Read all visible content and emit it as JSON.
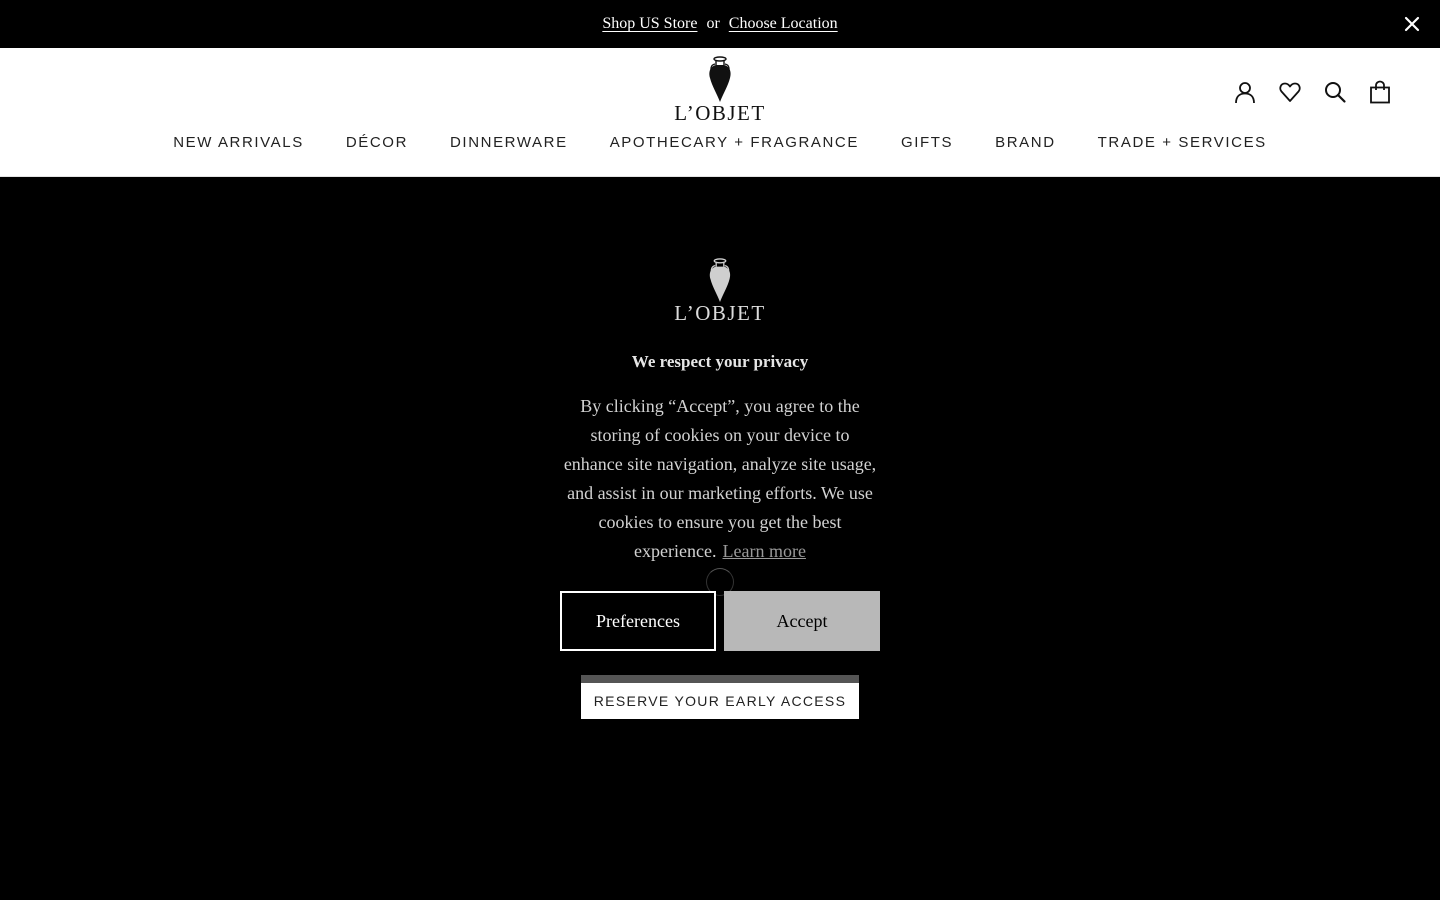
{
  "topbar": {
    "shop_us": "Shop US Store",
    "or": "or",
    "choose_location": "Choose Location"
  },
  "header": {
    "logo_text": "L’OBJET",
    "nav": [
      "NEW ARRIVALS",
      "DÉCOR",
      "DINNERWARE",
      "APOTHECARY + FRAGRANCE",
      "GIFTS",
      "BRAND",
      "TRADE + SERVICES"
    ],
    "icons": [
      "account-icon",
      "wishlist-heart-icon",
      "search-icon",
      "shopping-bag-icon"
    ]
  },
  "consent": {
    "logo_text": "L’OBJET",
    "title": "We respect your privacy",
    "body": "By clicking “Accept”, you agree to the storing of cookies on your device to enhance site navigation, analyze site usage, and assist in our marketing efforts. We use cookies to ensure you get the best experience.",
    "learn_more": "Learn more",
    "preferences": "Preferences",
    "accept": "Accept"
  },
  "reserve": {
    "label": "RESERVE YOUR EARLY ACCESS"
  },
  "colors": {
    "accent_button": "#b8b8b8",
    "background": "#000000",
    "header_bg": "#ffffff"
  }
}
